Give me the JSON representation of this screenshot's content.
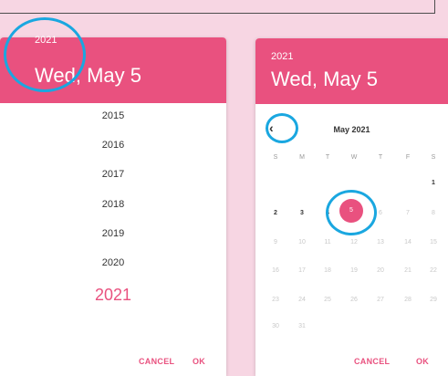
{
  "left_picker": {
    "year": "2021",
    "date": "Wed, May 5",
    "years": [
      "2015",
      "2016",
      "2017",
      "2018",
      "2019",
      "2020"
    ],
    "selected_year": "2021",
    "cancel": "CANCEL",
    "ok": "OK"
  },
  "right_picker": {
    "year": "2021",
    "date": "Wed, May 5",
    "month": "May 2021",
    "prev_icon": "chevron-left-icon",
    "weekdays": [
      "S",
      "M",
      "T",
      "W",
      "T",
      "F",
      "S"
    ],
    "days": [
      "1",
      "2",
      "3",
      "4",
      "5",
      "6",
      "7",
      "8",
      "9",
      "10",
      "11",
      "12",
      "13",
      "14",
      "15",
      "16",
      "17",
      "18",
      "19",
      "20",
      "21",
      "22",
      "23",
      "24",
      "25",
      "26",
      "27",
      "28",
      "29",
      "30",
      "31"
    ],
    "selected_day": "5",
    "cancel": "CANCEL",
    "ok": "OK"
  },
  "colors": {
    "accent": "#e9517f",
    "highlight_ring": "#1aa7e0",
    "background": "#f7d6e3"
  }
}
